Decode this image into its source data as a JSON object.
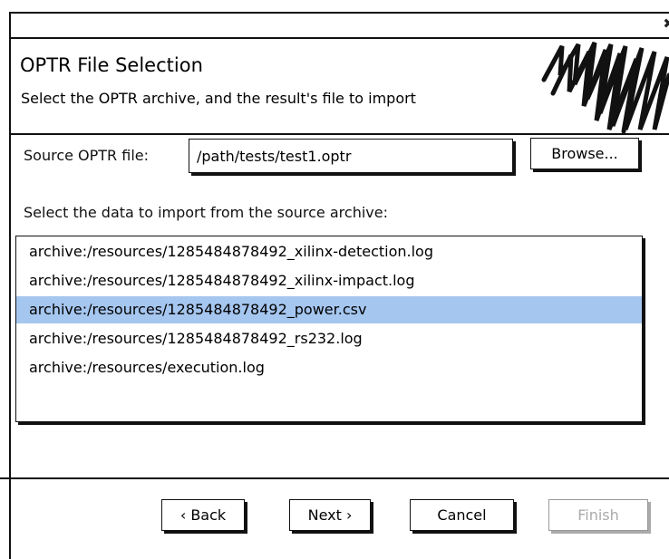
{
  "window": {
    "close_glyph": "✖"
  },
  "header": {
    "title": "OPTR File Selection",
    "subtitle": "Select the OPTR archive, and the result's file to import",
    "logo_icon": "scribble-icon"
  },
  "source": {
    "label": "Source OPTR file:",
    "value": "/path/tests/test1.optr",
    "browse_label": "Browse..."
  },
  "data_section": {
    "label": "Select the data to import from the source archive:",
    "items": [
      {
        "label": "archive:/resources/1285484878492_xilinx-detection.log",
        "selected": false
      },
      {
        "label": "archive:/resources/1285484878492_xilinx-impact.log",
        "selected": false
      },
      {
        "label": "archive:/resources/1285484878492_power.csv",
        "selected": true
      },
      {
        "label": "archive:/resources/1285484878492_rs232.log",
        "selected": false
      },
      {
        "label": "archive:/resources/execution.log",
        "selected": false
      }
    ],
    "selected_color": "#a5c6ef"
  },
  "footer": {
    "back_label": "‹ Back",
    "next_label": "Next ›",
    "cancel_label": "Cancel",
    "finish_label": "Finish",
    "finish_enabled": false
  }
}
